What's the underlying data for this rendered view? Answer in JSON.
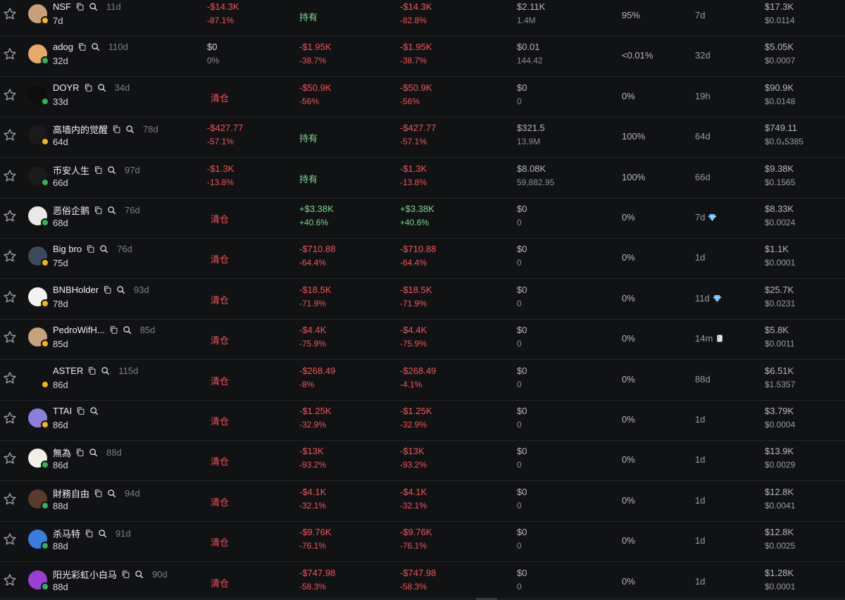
{
  "colors": {
    "background": "#111214",
    "loss": "#f2545b",
    "gain": "#7bd88f",
    "divider": "#25262a"
  },
  "icons": {
    "favorite": "star-outline-icon",
    "copy": "copy-icon",
    "search": "search-icon",
    "top_holder": "diamond-icon",
    "new_holder": "fish-icon"
  },
  "rows": [
    {
      "name": "NSF",
      "age": "11d",
      "held_for": "7d",
      "avatar_color": "#c9a07a",
      "chain_color": "#f0b90b",
      "col2_top": "-$14.3K",
      "col2_bottom": "-87.1%",
      "col2_type": "loss",
      "col3_top": "持有",
      "col3_bottom": "",
      "col3_type": "hold",
      "col4_top": "-$14.3K",
      "col4_bottom": "-82.8%",
      "col4_type": "loss",
      "bal_top": "$2.11K",
      "bal_bottom": "1.4M",
      "pct": "95%",
      "dur": "7d",
      "badge": "",
      "mc": "$17.3K",
      "price": "$0.0114"
    },
    {
      "name": "adog",
      "age": "110d",
      "held_for": "32d",
      "avatar_color": "#e5a96a",
      "chain_color": "#2fb45a",
      "col2_top": "$0",
      "col2_bottom": "0%",
      "col2_type": "neutral",
      "col3_top": "-$1.95K",
      "col3_bottom": "-38.7%",
      "col3_type": "loss",
      "col4_top": "-$1.95K",
      "col4_bottom": "-38.7%",
      "col4_type": "loss",
      "bal_top": "$0.01",
      "bal_bottom": "144.42",
      "pct": "<0.01%",
      "dur": "32d",
      "badge": "",
      "mc": "$5.05K",
      "price": "$0.0007"
    },
    {
      "name": "DOYR",
      "age": "34d",
      "held_for": "33d",
      "avatar_color": "#0d0d0d",
      "chain_color": "#2fb45a",
      "col2_top": "清仓",
      "col2_bottom": "",
      "col2_type": "sold",
      "col3_top": "-$50.9K",
      "col3_bottom": "-56%",
      "col3_type": "loss",
      "col4_top": "-$50.9K",
      "col4_bottom": "-56%",
      "col4_type": "loss",
      "bal_top": "$0",
      "bal_bottom": "0",
      "pct": "0%",
      "dur": "19h",
      "badge": "",
      "mc": "$90.9K",
      "price": "$0.0148"
    },
    {
      "name": "高墙内的觉醒",
      "age": "78d",
      "held_for": "64d",
      "avatar_color": "#1a1a1a",
      "chain_color": "#f0b90b",
      "col2_top": "-$427.77",
      "col2_bottom": "-57.1%",
      "col2_type": "loss",
      "col3_top": "持有",
      "col3_bottom": "",
      "col3_type": "hold",
      "col4_top": "-$427.77",
      "col4_bottom": "-57.1%",
      "col4_type": "loss",
      "bal_top": "$321.5",
      "bal_bottom": "13.9M",
      "pct": "100%",
      "dur": "64d",
      "badge": "",
      "mc": "$749.11",
      "price": "$0.0₄5385"
    },
    {
      "name": "币安人生",
      "age": "97d",
      "held_for": "66d",
      "avatar_color": "#1a1a1a",
      "chain_color": "#2fb45a",
      "col2_top": "-$1.3K",
      "col2_bottom": "-13.8%",
      "col2_type": "loss",
      "col3_top": "持有",
      "col3_bottom": "",
      "col3_type": "hold",
      "col4_top": "-$1.3K",
      "col4_bottom": "-13.8%",
      "col4_type": "loss",
      "bal_top": "$8.08K",
      "bal_bottom": "59,882.95",
      "pct": "100%",
      "dur": "66d",
      "badge": "",
      "mc": "$9.38K",
      "price": "$0.1565"
    },
    {
      "name": "恶俗企鹅",
      "age": "76d",
      "held_for": "68d",
      "avatar_color": "#e9e9e9",
      "chain_color": "#2fb45a",
      "col2_top": "清仓",
      "col2_bottom": "",
      "col2_type": "sold",
      "col3_top": "+$3.38K",
      "col3_bottom": "+40.6%",
      "col3_type": "gain",
      "col4_top": "+$3.38K",
      "col4_bottom": "+40.6%",
      "col4_type": "gain",
      "bal_top": "$0",
      "bal_bottom": "0",
      "pct": "0%",
      "dur": "7d",
      "badge": "diamond",
      "mc": "$8.33K",
      "price": "$0.0024"
    },
    {
      "name": "Big bro",
      "age": "76d",
      "held_for": "75d",
      "avatar_color": "#3b4a5c",
      "chain_color": "#f0b90b",
      "col2_top": "清仓",
      "col2_bottom": "",
      "col2_type": "sold",
      "col3_top": "-$710.88",
      "col3_bottom": "-64.4%",
      "col3_type": "loss",
      "col4_top": "-$710.88",
      "col4_bottom": "-64.4%",
      "col4_type": "loss",
      "bal_top": "$0",
      "bal_bottom": "0",
      "pct": "0%",
      "dur": "1d",
      "badge": "",
      "mc": "$1.1K",
      "price": "$0.0001"
    },
    {
      "name": "BNBHolder",
      "age": "93d",
      "held_for": "78d",
      "avatar_color": "#f3f3f3",
      "chain_color": "#f0b90b",
      "col2_top": "清仓",
      "col2_bottom": "",
      "col2_type": "sold",
      "col3_top": "-$18.5K",
      "col3_bottom": "-71.9%",
      "col3_type": "loss",
      "col4_top": "-$18.5K",
      "col4_bottom": "-71.9%",
      "col4_type": "loss",
      "bal_top": "$0",
      "bal_bottom": "0",
      "pct": "0%",
      "dur": "11d",
      "badge": "diamond",
      "mc": "$25.7K",
      "price": "$0.0231"
    },
    {
      "name": "PedroWifH...",
      "age": "85d",
      "held_for": "85d",
      "avatar_color": "#c7a27c",
      "chain_color": "#f0b90b",
      "col2_top": "清仓",
      "col2_bottom": "",
      "col2_type": "sold",
      "col3_top": "-$4.4K",
      "col3_bottom": "-75.9%",
      "col3_type": "loss",
      "col4_top": "-$4.4K",
      "col4_bottom": "-75.9%",
      "col4_type": "loss",
      "bal_top": "$0",
      "bal_bottom": "0",
      "pct": "0%",
      "dur": "14m",
      "badge": "fish",
      "mc": "$5.8K",
      "price": "$0.0011"
    },
    {
      "name": "ASTER",
      "age": "115d",
      "held_for": "86d",
      "avatar_color": "#111214",
      "chain_color": "#f0b90b",
      "col2_top": "清仓",
      "col2_bottom": "",
      "col2_type": "sold",
      "col3_top": "-$268.49",
      "col3_bottom": "-8%",
      "col3_type": "loss",
      "col4_top": "-$268.49",
      "col4_bottom": "-4.1%",
      "col4_type": "loss",
      "bal_top": "$0",
      "bal_bottom": "0",
      "pct": "0%",
      "dur": "88d",
      "badge": "",
      "mc": "$6.51K",
      "price": "$1.5357"
    },
    {
      "name": "TTAI",
      "age": "",
      "held_for": "86d",
      "avatar_color": "#8b7fd9",
      "chain_color": "#f0b90b",
      "col2_top": "清仓",
      "col2_bottom": "",
      "col2_type": "sold",
      "col3_top": "-$1.25K",
      "col3_bottom": "-32.9%",
      "col3_type": "loss",
      "col4_top": "-$1.25K",
      "col4_bottom": "-32.9%",
      "col4_type": "loss",
      "bal_top": "$0",
      "bal_bottom": "0",
      "pct": "0%",
      "dur": "1d",
      "badge": "",
      "mc": "$3.79K",
      "price": "$0.0004"
    },
    {
      "name": "無為",
      "age": "88d",
      "held_for": "86d",
      "avatar_color": "#f0efe8",
      "chain_color": "#2fb45a",
      "col2_top": "清仓",
      "col2_bottom": "",
      "col2_type": "sold",
      "col3_top": "-$13K",
      "col3_bottom": "-93.2%",
      "col3_type": "loss",
      "col4_top": "-$13K",
      "col4_bottom": "-93.2%",
      "col4_type": "loss",
      "bal_top": "$0",
      "bal_bottom": "0",
      "pct": "0%",
      "dur": "1d",
      "badge": "",
      "mc": "$13.9K",
      "price": "$0.0029"
    },
    {
      "name": "財務自由",
      "age": "94d",
      "held_for": "88d",
      "avatar_color": "#5a3a2a",
      "chain_color": "#2fb45a",
      "col2_top": "清仓",
      "col2_bottom": "",
      "col2_type": "sold",
      "col3_top": "-$4.1K",
      "col3_bottom": "-32.1%",
      "col3_type": "loss",
      "col4_top": "-$4.1K",
      "col4_bottom": "-32.1%",
      "col4_type": "loss",
      "bal_top": "$0",
      "bal_bottom": "0",
      "pct": "0%",
      "dur": "1d",
      "badge": "",
      "mc": "$12.8K",
      "price": "$0.0041"
    },
    {
      "name": "杀马特",
      "age": "91d",
      "held_for": "88d",
      "avatar_color": "#3a7be0",
      "chain_color": "#2fb45a",
      "col2_top": "清仓",
      "col2_bottom": "",
      "col2_type": "sold",
      "col3_top": "-$9.76K",
      "col3_bottom": "-76.1%",
      "col3_type": "loss",
      "col4_top": "-$9.76K",
      "col4_bottom": "-76.1%",
      "col4_type": "loss",
      "bal_top": "$0",
      "bal_bottom": "0",
      "pct": "0%",
      "dur": "1d",
      "badge": "",
      "mc": "$12.8K",
      "price": "$0.0025"
    },
    {
      "name": "阳光彩虹小白马",
      "age": "90d",
      "held_for": "88d",
      "avatar_color": "#9a3fd1",
      "chain_color": "#2fb45a",
      "col2_top": "清仓",
      "col2_bottom": "",
      "col2_type": "sold",
      "col3_top": "-$747.98",
      "col3_bottom": "-58.3%",
      "col3_type": "loss",
      "col4_top": "-$747.98",
      "col4_bottom": "-58.3%",
      "col4_type": "loss",
      "bal_top": "$0",
      "bal_bottom": "0",
      "pct": "0%",
      "dur": "1d",
      "badge": "",
      "mc": "$1.28K",
      "price": "$0.0001"
    }
  ]
}
